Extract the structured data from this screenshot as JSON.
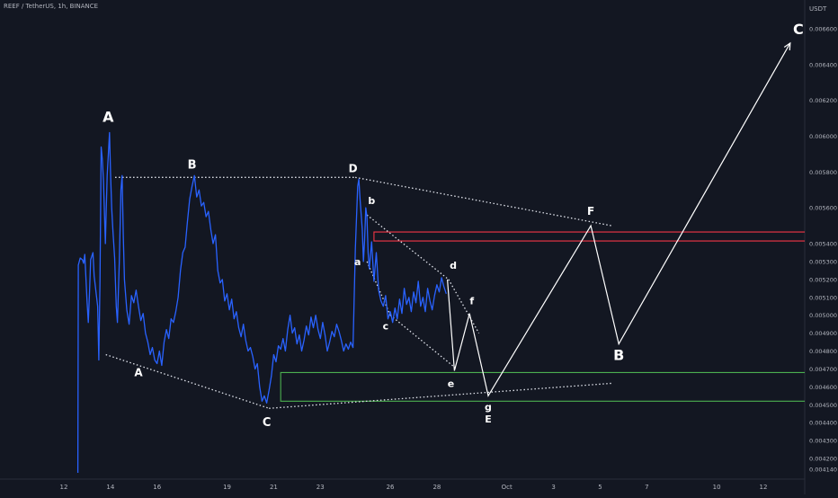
{
  "header": {
    "symbol_title": "REEF / TetherUS, 1h, BINANCE"
  },
  "chart_data": {
    "type": "line",
    "title": "REEF / TetherUS, 1h, BINANCE",
    "ylabel": "USDT",
    "ylim": [
      0.0041,
      0.00675
    ],
    "y_ticks": [
      "0.006600",
      "0.006400",
      "0.006200",
      "0.006000",
      "0.005800",
      "0.005600",
      "0.005400",
      "0.005300",
      "0.005200",
      "0.005100",
      "0.005000",
      "0.004900",
      "0.004800",
      "0.004700",
      "0.004600",
      "0.004500",
      "0.004400",
      "0.004300",
      "0.004200",
      "0.004140"
    ],
    "x_range": [
      11.9,
      43.8
    ],
    "x_ticks": [
      {
        "label": "12",
        "x": 12
      },
      {
        "label": "14",
        "x": 14
      },
      {
        "label": "16",
        "x": 16
      },
      {
        "label": "19",
        "x": 19
      },
      {
        "label": "21",
        "x": 21
      },
      {
        "label": "23",
        "x": 23
      },
      {
        "label": "26",
        "x": 26
      },
      {
        "label": "28",
        "x": 28
      },
      {
        "label": "Oct",
        "x": 31
      },
      {
        "label": "3",
        "x": 33
      },
      {
        "label": "5",
        "x": 35
      },
      {
        "label": "7",
        "x": 37
      },
      {
        "label": "10",
        "x": 40
      },
      {
        "label": "12",
        "x": 42
      }
    ],
    "series": [
      {
        "color": "#2962ff",
        "points": [
          [
            12.6,
            0.00412
          ],
          [
            12.62,
            0.00528
          ],
          [
            12.7,
            0.00532
          ],
          [
            12.8,
            0.00531
          ],
          [
            12.85,
            0.00529
          ],
          [
            12.9,
            0.00534
          ],
          [
            13.0,
            0.00507
          ],
          [
            13.05,
            0.00496
          ],
          [
            13.1,
            0.00512
          ],
          [
            13.15,
            0.00531
          ],
          [
            13.25,
            0.00535
          ],
          [
            13.3,
            0.00522
          ],
          [
            13.45,
            0.00505
          ],
          [
            13.5,
            0.00475
          ],
          [
            13.55,
            0.00519
          ],
          [
            13.6,
            0.00594
          ],
          [
            13.65,
            0.00587
          ],
          [
            13.7,
            0.00575
          ],
          [
            13.78,
            0.0054
          ],
          [
            13.82,
            0.0056
          ],
          [
            13.86,
            0.00578
          ],
          [
            13.9,
            0.00588
          ],
          [
            13.96,
            0.00602
          ],
          [
            14.0,
            0.0058
          ],
          [
            14.05,
            0.0056
          ],
          [
            14.1,
            0.00548
          ],
          [
            14.18,
            0.00532
          ],
          [
            14.25,
            0.00505
          ],
          [
            14.3,
            0.00496
          ],
          [
            14.38,
            0.0053
          ],
          [
            14.45,
            0.0057
          ],
          [
            14.5,
            0.00578
          ],
          [
            14.55,
            0.00545
          ],
          [
            14.6,
            0.0052
          ],
          [
            14.7,
            0.00503
          ],
          [
            14.8,
            0.00495
          ],
          [
            14.9,
            0.00511
          ],
          [
            15.0,
            0.00507
          ],
          [
            15.1,
            0.00514
          ],
          [
            15.2,
            0.00505
          ],
          [
            15.3,
            0.00497
          ],
          [
            15.4,
            0.00501
          ],
          [
            15.5,
            0.0049
          ],
          [
            15.6,
            0.00485
          ],
          [
            15.7,
            0.00478
          ],
          [
            15.8,
            0.00482
          ],
          [
            15.9,
            0.00475
          ],
          [
            16.0,
            0.00473
          ],
          [
            16.1,
            0.0048
          ],
          [
            16.2,
            0.00472
          ],
          [
            16.3,
            0.00485
          ],
          [
            16.4,
            0.00492
          ],
          [
            16.5,
            0.00487
          ],
          [
            16.6,
            0.00498
          ],
          [
            16.7,
            0.00496
          ],
          [
            16.8,
            0.00502
          ],
          [
            16.9,
            0.0051
          ],
          [
            17.0,
            0.00525
          ],
          [
            17.1,
            0.00535
          ],
          [
            17.2,
            0.00538
          ],
          [
            17.3,
            0.00552
          ],
          [
            17.4,
            0.00565
          ],
          [
            17.5,
            0.00572
          ],
          [
            17.6,
            0.00578
          ],
          [
            17.7,
            0.00566
          ],
          [
            17.8,
            0.0057
          ],
          [
            17.9,
            0.00561
          ],
          [
            18.0,
            0.00563
          ],
          [
            18.1,
            0.00555
          ],
          [
            18.2,
            0.00558
          ],
          [
            18.3,
            0.00548
          ],
          [
            18.4,
            0.0054
          ],
          [
            18.5,
            0.00545
          ],
          [
            18.6,
            0.00525
          ],
          [
            18.7,
            0.00518
          ],
          [
            18.8,
            0.0052
          ],
          [
            18.9,
            0.00508
          ],
          [
            19.0,
            0.00512
          ],
          [
            19.1,
            0.00503
          ],
          [
            19.2,
            0.00509
          ],
          [
            19.3,
            0.00498
          ],
          [
            19.4,
            0.00502
          ],
          [
            19.5,
            0.00493
          ],
          [
            19.6,
            0.00488
          ],
          [
            19.7,
            0.00495
          ],
          [
            19.8,
            0.00486
          ],
          [
            19.9,
            0.0048
          ],
          [
            20.0,
            0.00482
          ],
          [
            20.1,
            0.00477
          ],
          [
            20.2,
            0.0047
          ],
          [
            20.3,
            0.00473
          ],
          [
            20.4,
            0.0046
          ],
          [
            20.5,
            0.00452
          ],
          [
            20.6,
            0.00455
          ],
          [
            20.7,
            0.00451
          ],
          [
            20.8,
            0.00458
          ],
          [
            20.9,
            0.00466
          ],
          [
            21.0,
            0.00478
          ],
          [
            21.1,
            0.00474
          ],
          [
            21.2,
            0.00483
          ],
          [
            21.3,
            0.00481
          ],
          [
            21.4,
            0.00487
          ],
          [
            21.5,
            0.0048
          ],
          [
            21.6,
            0.00492
          ],
          [
            21.7,
            0.005
          ],
          [
            21.8,
            0.0049
          ],
          [
            21.9,
            0.00493
          ],
          [
            22.0,
            0.00484
          ],
          [
            22.1,
            0.00489
          ],
          [
            22.2,
            0.0048
          ],
          [
            22.3,
            0.00486
          ],
          [
            22.4,
            0.00494
          ],
          [
            22.5,
            0.00489
          ],
          [
            22.6,
            0.00499
          ],
          [
            22.7,
            0.00493
          ],
          [
            22.8,
            0.005
          ],
          [
            22.9,
            0.00492
          ],
          [
            23.0,
            0.00487
          ],
          [
            23.1,
            0.00496
          ],
          [
            23.2,
            0.00489
          ],
          [
            23.3,
            0.0048
          ],
          [
            23.4,
            0.00485
          ],
          [
            23.5,
            0.00491
          ],
          [
            23.6,
            0.00488
          ],
          [
            23.7,
            0.00495
          ],
          [
            23.8,
            0.00491
          ],
          [
            23.9,
            0.00486
          ],
          [
            24.0,
            0.0048
          ],
          [
            24.1,
            0.00484
          ],
          [
            24.2,
            0.00481
          ],
          [
            24.3,
            0.00485
          ],
          [
            24.4,
            0.00482
          ],
          [
            24.5,
            0.00537
          ],
          [
            24.6,
            0.00572
          ],
          [
            24.65,
            0.00576
          ],
          [
            24.7,
            0.00565
          ],
          [
            24.8,
            0.00548
          ],
          [
            24.85,
            0.0053
          ],
          [
            24.9,
            0.00542
          ],
          [
            24.95,
            0.0056
          ],
          [
            25.0,
            0.00555
          ],
          [
            25.05,
            0.00535
          ],
          [
            25.1,
            0.00526
          ],
          [
            25.2,
            0.00541
          ],
          [
            25.3,
            0.00519
          ],
          [
            25.4,
            0.00535
          ],
          [
            25.5,
            0.00514
          ],
          [
            25.6,
            0.00508
          ],
          [
            25.7,
            0.00505
          ],
          [
            25.8,
            0.00511
          ],
          [
            25.9,
            0.00498
          ],
          [
            26.0,
            0.00502
          ],
          [
            26.1,
            0.00496
          ],
          [
            26.2,
            0.00504
          ],
          [
            26.3,
            0.00498
          ],
          [
            26.4,
            0.00509
          ],
          [
            26.5,
            0.00501
          ],
          [
            26.6,
            0.00515
          ],
          [
            26.7,
            0.00506
          ],
          [
            26.8,
            0.0051
          ],
          [
            26.9,
            0.00502
          ],
          [
            27.0,
            0.00513
          ],
          [
            27.1,
            0.00507
          ],
          [
            27.2,
            0.00519
          ],
          [
            27.3,
            0.00505
          ],
          [
            27.4,
            0.0051
          ],
          [
            27.5,
            0.00502
          ],
          [
            27.6,
            0.00515
          ],
          [
            27.7,
            0.00508
          ],
          [
            27.8,
            0.00503
          ],
          [
            27.9,
            0.00511
          ],
          [
            28.0,
            0.00517
          ],
          [
            28.1,
            0.00513
          ],
          [
            28.2,
            0.00521
          ],
          [
            28.3,
            0.00516
          ],
          [
            28.4,
            0.00512
          ]
        ]
      }
    ],
    "projection": {
      "color": "#ffffff",
      "points": [
        [
          28.45,
          0.0052
        ],
        [
          28.75,
          0.00469
        ],
        [
          29.4,
          0.00501
        ],
        [
          30.2,
          0.00455
        ],
        [
          34.6,
          0.0055
        ],
        [
          35.8,
          0.00484
        ],
        [
          43.15,
          0.00652
        ]
      ]
    },
    "dotted_lines": [
      {
        "from": [
          14.2,
          0.00577
        ],
        "to": [
          24.5,
          0.00577
        ]
      },
      {
        "from": [
          24.5,
          0.00577
        ],
        "to": [
          35.5,
          0.0055
        ]
      },
      {
        "from": [
          13.8,
          0.00478
        ],
        "to": [
          20.8,
          0.00448
        ]
      },
      {
        "from": [
          20.8,
          0.00448
        ],
        "to": [
          35.5,
          0.00462
        ]
      },
      {
        "from": [
          25.0,
          0.00556
        ],
        "to": [
          28.5,
          0.0052
        ]
      },
      {
        "from": [
          28.5,
          0.0052
        ],
        "to": [
          29.8,
          0.0049
        ]
      },
      {
        "from": [
          25.0,
          0.0053
        ],
        "to": [
          26.0,
          0.005
        ]
      },
      {
        "from": [
          26.0,
          0.005
        ],
        "to": [
          28.85,
          0.0047
        ]
      }
    ],
    "zones": [
      {
        "color": "#f23645",
        "x_start": 25.3,
        "y_top": 0.005465,
        "y_bottom": 0.005415
      },
      {
        "color": "#26a69a",
        "x_start": 21.3,
        "y_top": 0.00468,
        "y_bottom": 0.00452
      },
      {
        "color": "#4caf50",
        "x_start": 21.3,
        "y_top": 0.00468,
        "y_bottom": 0.00452
      }
    ],
    "annotations": [
      {
        "text": "A",
        "x": 13.9,
        "y": 0.00608,
        "size": 16
      },
      {
        "text": "B",
        "x": 17.5,
        "y": 0.00582,
        "size": 13
      },
      {
        "text": "A",
        "x": 15.2,
        "y": 0.00466,
        "size": 12
      },
      {
        "text": "C",
        "x": 20.7,
        "y": 0.00438,
        "size": 13
      },
      {
        "text": "D",
        "x": 24.4,
        "y": 0.0058,
        "size": 12
      },
      {
        "text": "b",
        "x": 25.2,
        "y": 0.00562,
        "size": 11
      },
      {
        "text": "a",
        "x": 24.6,
        "y": 0.00528,
        "size": 11
      },
      {
        "text": "c",
        "x": 25.8,
        "y": 0.00492,
        "size": 11
      },
      {
        "text": "d",
        "x": 28.7,
        "y": 0.00526,
        "size": 11
      },
      {
        "text": "f",
        "x": 29.5,
        "y": 0.00506,
        "size": 11
      },
      {
        "text": "e",
        "x": 28.6,
        "y": 0.0046,
        "size": 11
      },
      {
        "text": "g",
        "x": 30.2,
        "y": 0.00447,
        "size": 11
      },
      {
        "text": "E",
        "x": 30.2,
        "y": 0.0044,
        "size": 11
      },
      {
        "text": "F",
        "x": 34.6,
        "y": 0.00556,
        "size": 12
      },
      {
        "text": "B",
        "x": 35.8,
        "y": 0.00475,
        "size": 16
      },
      {
        "text": "C",
        "x": 43.5,
        "y": 0.00657,
        "size": 16
      }
    ],
    "grid": false,
    "legend": false
  },
  "colors": {
    "background": "#131722",
    "axis_text": "#b2b5be",
    "price_line": "#2962ff",
    "projection": "#ffffff",
    "resistance": "#f23645",
    "support": "#4caf50"
  }
}
